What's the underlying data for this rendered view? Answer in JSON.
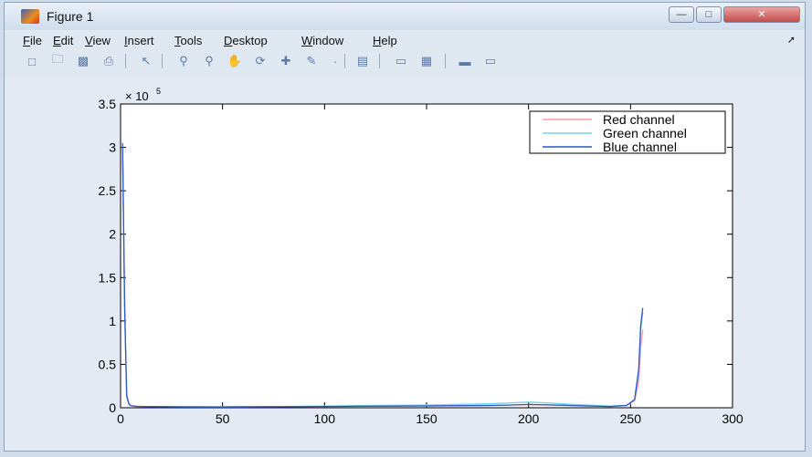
{
  "window": {
    "title": "Figure 1"
  },
  "menu": [
    "File",
    "Edit",
    "View",
    "Insert",
    "Tools",
    "Desktop",
    "Window",
    "Help"
  ],
  "toolbar": {
    "icons": [
      "new-figure-icon",
      "open-file-icon",
      "save-icon",
      "print-icon",
      "edit-plot-arrow-icon",
      "zoom-in-icon",
      "zoom-out-icon",
      "pan-hand-icon",
      "rotate-3d-icon",
      "data-cursor-icon",
      "brush-icon",
      "link-plot-icon",
      "colorbar-icon",
      "legend-icon",
      "hide-plot-tools-icon",
      "show-plot-tools-icon"
    ]
  },
  "chart_data": {
    "type": "line",
    "title": "",
    "xlabel": "",
    "ylabel": "",
    "xlim": [
      0,
      300
    ],
    "ylim": [
      0,
      350000
    ],
    "x_ticks": [
      "0",
      "50",
      "100",
      "150",
      "200",
      "250",
      "300"
    ],
    "y_ticks": [
      "0",
      "0.5",
      "1",
      "1.5",
      "2",
      "2.5",
      "3",
      "3.5"
    ],
    "y_exponent": "× 10",
    "y_exponent_power": "5",
    "legend_position": "top-right",
    "grid": false,
    "series": [
      {
        "name": "Red channel",
        "color": "#ff9aa0",
        "x": [
          1,
          2,
          3,
          4,
          5,
          8,
          15,
          30,
          50,
          80,
          100,
          120,
          150,
          180,
          190,
          200,
          210,
          220,
          230,
          240,
          248,
          252,
          254,
          255,
          256
        ],
        "y": [
          290000,
          120000,
          15000,
          5000,
          2500,
          1800,
          1500,
          1200,
          1000,
          1300,
          1600,
          1800,
          2000,
          2400,
          3000,
          3600,
          3200,
          2600,
          2000,
          1500,
          2500,
          8000,
          30000,
          70000,
          90000
        ]
      },
      {
        "name": "Green channel",
        "color": "#6fd8ea",
        "x": [
          1,
          2,
          3,
          4,
          5,
          8,
          15,
          30,
          50,
          80,
          100,
          120,
          150,
          180,
          190,
          200,
          210,
          220,
          230,
          240,
          248,
          252,
          254,
          255,
          256
        ],
        "y": [
          300000,
          110000,
          13000,
          4500,
          2200,
          1600,
          1400,
          1100,
          1000,
          1500,
          2000,
          2600,
          3200,
          4500,
          5500,
          6500,
          5500,
          4000,
          3000,
          2000,
          2800,
          9000,
          40000,
          90000,
          110000
        ]
      },
      {
        "name": "Blue channel",
        "color": "#2f55c8",
        "x": [
          1,
          2,
          3,
          4,
          5,
          8,
          15,
          30,
          50,
          80,
          100,
          120,
          150,
          180,
          190,
          200,
          210,
          220,
          230,
          240,
          248,
          252,
          254,
          255,
          256
        ],
        "y": [
          305000,
          115000,
          14000,
          4800,
          2300,
          1500,
          1300,
          1000,
          900,
          1200,
          1500,
          1700,
          2100,
          2600,
          3100,
          3800,
          3300,
          2600,
          2000,
          1500,
          2600,
          9500,
          45000,
          95000,
          115000
        ]
      }
    ]
  }
}
